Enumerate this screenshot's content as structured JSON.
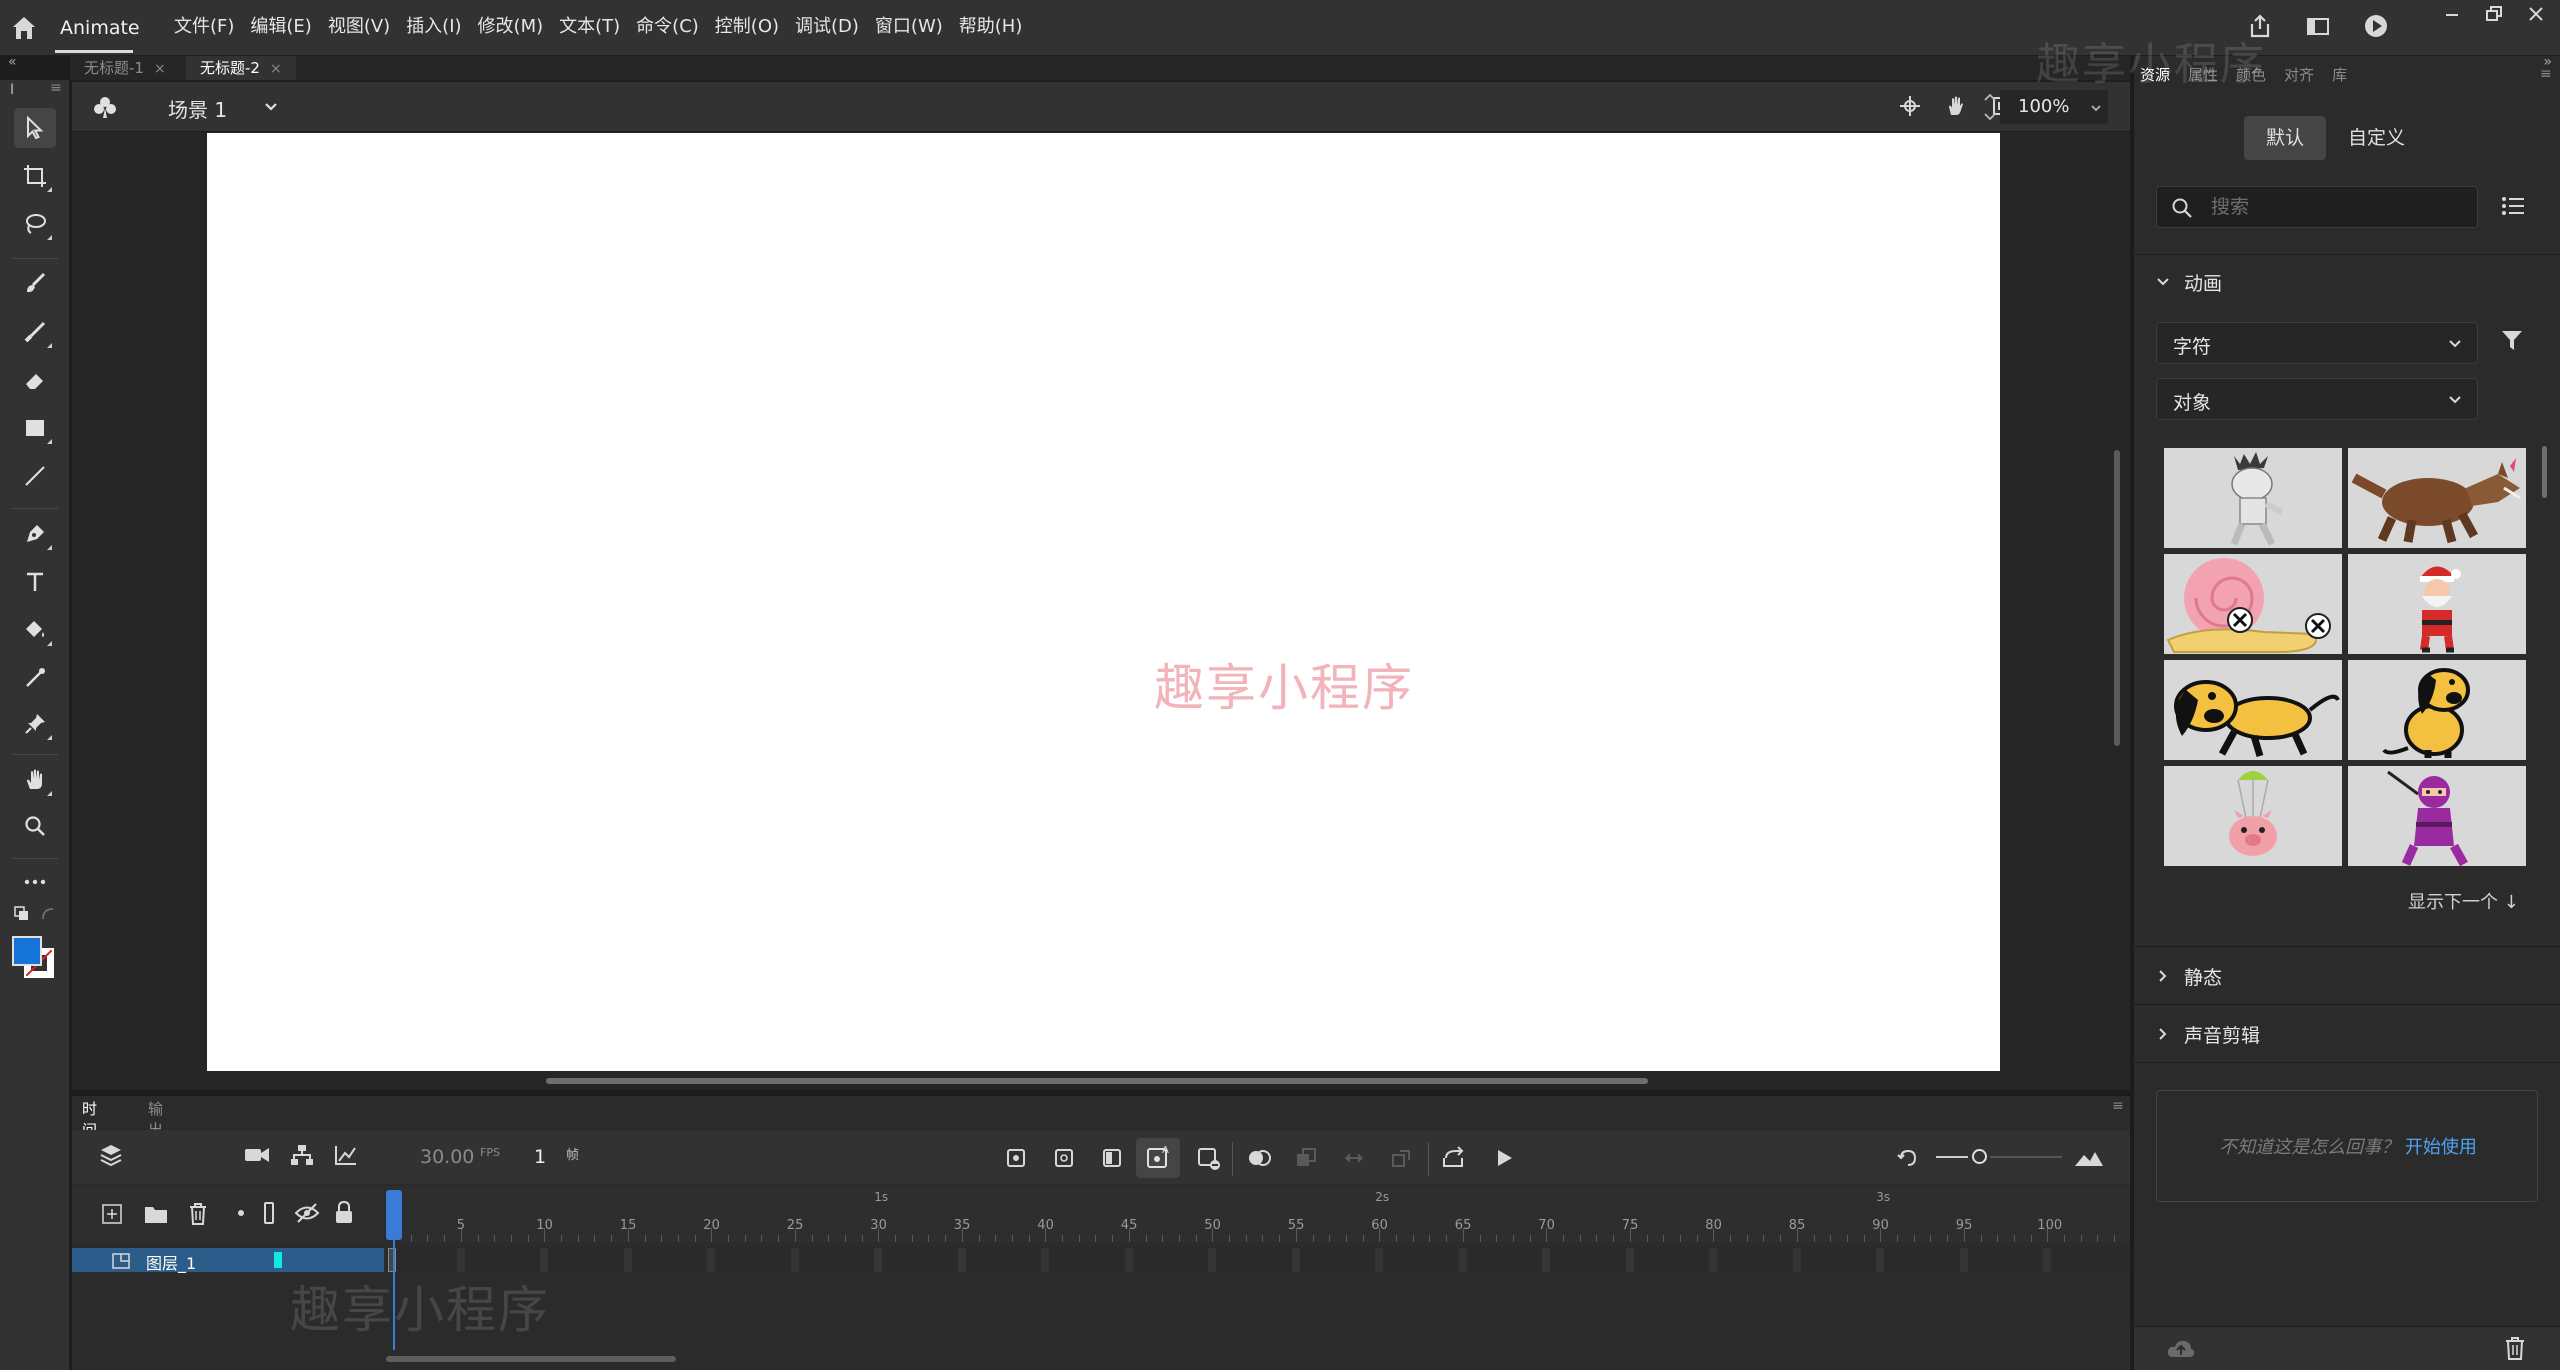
{
  "app": {
    "name": "Animate"
  },
  "menu": [
    "文件(F)",
    "编辑(E)",
    "视图(V)",
    "插入(I)",
    "修改(M)",
    "文本(T)",
    "命令(C)",
    "控制(O)",
    "调试(D)",
    "窗口(W)",
    "帮助(H)"
  ],
  "doc_tabs": [
    {
      "label": "无标题-1",
      "close": "×"
    },
    {
      "label": "无标题-2",
      "close": "×"
    }
  ],
  "toolbar": {
    "collapse_left": "«",
    "collapse_right": "»",
    "tools": [
      "selection-tool",
      "free-transform-tool",
      "lasso-tool",
      "paint-brush-tool",
      "brush-tool",
      "eraser-tool",
      "rectangle-tool",
      "line-tool",
      "pen-tool",
      "text-tool",
      "paint-bucket-tool",
      "eyedropper-tool",
      "pin-tool",
      "hand-tool",
      "zoom-tool",
      "more-tools"
    ],
    "stroke_color": "#ffffff",
    "fill_color": "#1673d8"
  },
  "stage": {
    "scene": "场景 1",
    "zoom": "100%",
    "background": "#ffffff",
    "watermark": "趣享小程序"
  },
  "timeline": {
    "tabs": [
      "时间轴",
      "输出"
    ],
    "fps": "30.00",
    "fps_unit": "FPS",
    "frame": "1",
    "frame_unit": "帧",
    "frame_ticks": [
      5,
      10,
      15,
      20,
      25,
      30,
      35,
      40,
      45,
      50,
      55,
      60,
      65,
      70,
      75,
      80,
      85,
      90,
      95,
      100
    ],
    "second_marks": [
      "1s",
      "2s",
      "3s"
    ],
    "layer": {
      "name": "图层_1",
      "color": "#11e7e7"
    },
    "watermark": "趣享小程序"
  },
  "right_panel": {
    "tabs": [
      "资源",
      "属性",
      "颜色",
      "对齐",
      "库"
    ],
    "segments": [
      "默认",
      "自定义"
    ],
    "search_placeholder": "搜索",
    "section_animation": "动画",
    "dropdown_1": "字符",
    "dropdown_2": "对象",
    "assets": [
      "mummy",
      "werewolf",
      "snail",
      "santa",
      "dog-running",
      "dog-sitting",
      "pig-parachute",
      "ninja"
    ],
    "show_next": "显示下一个 ↓",
    "section_static": "静态",
    "section_sound": "声音剪辑",
    "help_text": "不知道这是怎么回事？",
    "help_link": "开始使用",
    "watermark": "趣享小程序"
  }
}
